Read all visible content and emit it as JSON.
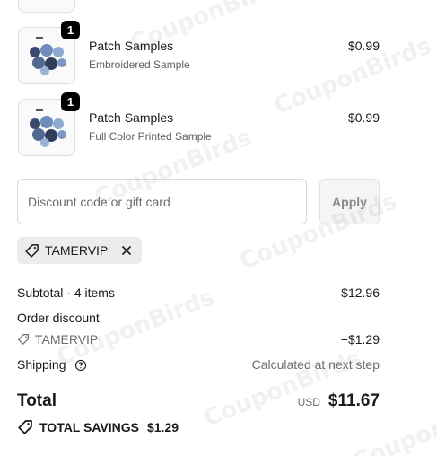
{
  "line_items": [
    {
      "quantity": "1",
      "title": "Patch Samples",
      "variant": "Embroidered Sample",
      "price": "$0.99"
    },
    {
      "quantity": "1",
      "title": "Patch Samples",
      "variant": "Full Color Printed Sample",
      "price": "$0.99"
    }
  ],
  "discount": {
    "placeholder": "Discount code or gift card",
    "apply_label": "Apply",
    "applied_code": "TAMERVIP"
  },
  "summary": {
    "subtotal_label": "Subtotal · 4 items",
    "subtotal_value": "$12.96",
    "order_discount_label": "Order discount",
    "discount_code": "TAMERVIP",
    "discount_value": "−$1.29",
    "shipping_label": "Shipping",
    "shipping_value": "Calculated at next step",
    "total_label": "Total",
    "currency": "USD",
    "total_value": "$11.67",
    "savings_label": "TOTAL SAVINGS",
    "savings_value": "$1.29"
  },
  "watermark_text": "CouponBirds",
  "icons": [
    "tag-icon",
    "close-icon",
    "help-circle-icon",
    "savings-tag-icon"
  ],
  "colors": {
    "badge": "#000000",
    "chip_bg": "#ececec",
    "muted_text": "#6d6d6d"
  }
}
